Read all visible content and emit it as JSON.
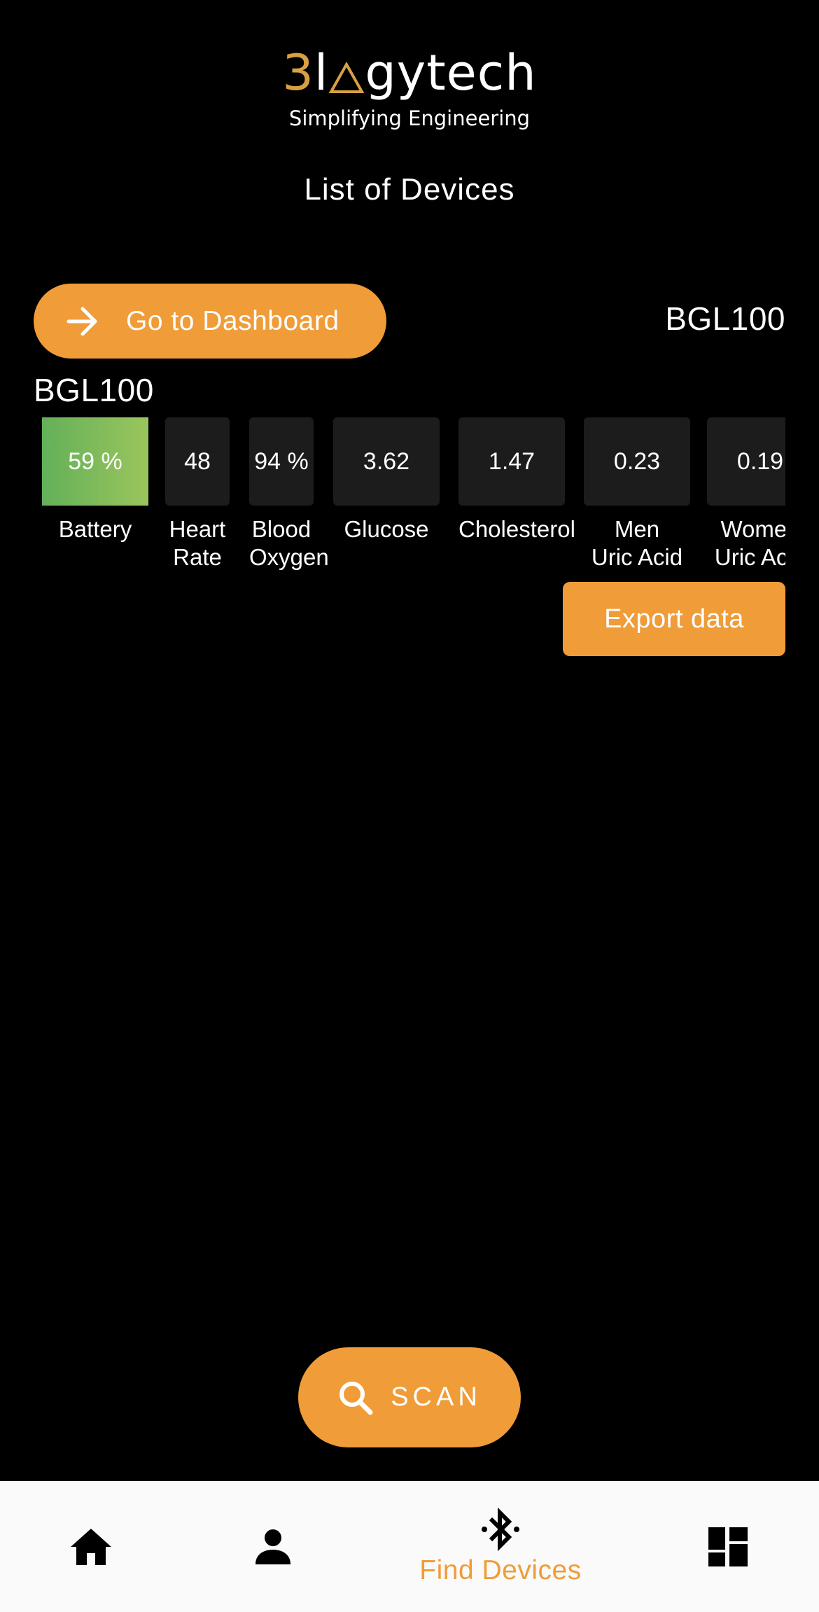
{
  "logo": {
    "prefix": "3l",
    "suffix": "gytech",
    "tagline": "Simplifying Engineering"
  },
  "page_title": "List of Devices",
  "dashboard_button": {
    "label": "Go to Dashboard",
    "icon": "arrow-right-icon"
  },
  "connected_device_name": "BGL100",
  "device": {
    "name": "BGL100",
    "metrics": [
      {
        "value": "59 %",
        "label": "Battery",
        "fill_fraction": 0.59
      },
      {
        "value": "48",
        "label": "Heart\nRate"
      },
      {
        "value": "94 %",
        "label": "Blood\nOxygen"
      },
      {
        "value": "3.62",
        "label": "Glucose"
      },
      {
        "value": "1.47",
        "label": "Cholesterol"
      },
      {
        "value": "0.23",
        "label": "Men\nUric Acid"
      },
      {
        "value": "0.19",
        "label": "Women\nUric Acid"
      }
    ]
  },
  "export_button": {
    "label": "Export data"
  },
  "scan_button": {
    "label": "SCAN",
    "icon": "search-icon"
  },
  "bottom_nav": {
    "items": [
      {
        "icon": "home-icon",
        "label": ""
      },
      {
        "icon": "person-icon",
        "label": ""
      },
      {
        "icon": "bluetooth-icon",
        "label": "Find Devices",
        "active": true
      },
      {
        "icon": "dashboard-icon",
        "label": ""
      }
    ]
  },
  "colors": {
    "accent": "#f09c38",
    "background": "#000000",
    "tile": "#1c1c1c",
    "battery_start": "#63b05a",
    "battery_end": "#9bc55c",
    "nav_background": "#fafafa"
  }
}
